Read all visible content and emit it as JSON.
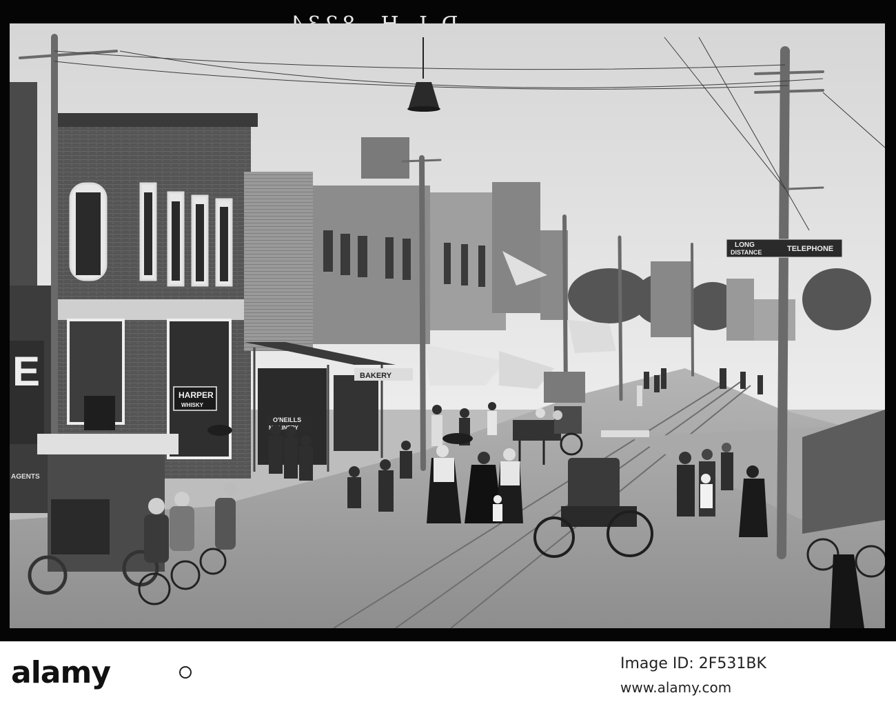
{
  "photo": {
    "negative_label": "D.L.H. 8234",
    "signs": {
      "harper": "HARPER",
      "whisky": "WHISKY",
      "millinery_store": "O'NEILLS",
      "millinery": "MILLINERY",
      "bakery": "BAKERY",
      "long": "LONG",
      "distance": "DISTANCE",
      "telephone": "TELEPHONE",
      "wall_letter": "E",
      "agents": "AGENTS"
    }
  },
  "watermark": {
    "brand": "alamy",
    "image_id_label": "Image ID: 2F531BK",
    "url": "www.alamy.com"
  },
  "colors": {
    "frame": "#050505",
    "sky": "#e4e4e4",
    "street": "#9a9a9a",
    "brick": "#5a5a5a"
  }
}
